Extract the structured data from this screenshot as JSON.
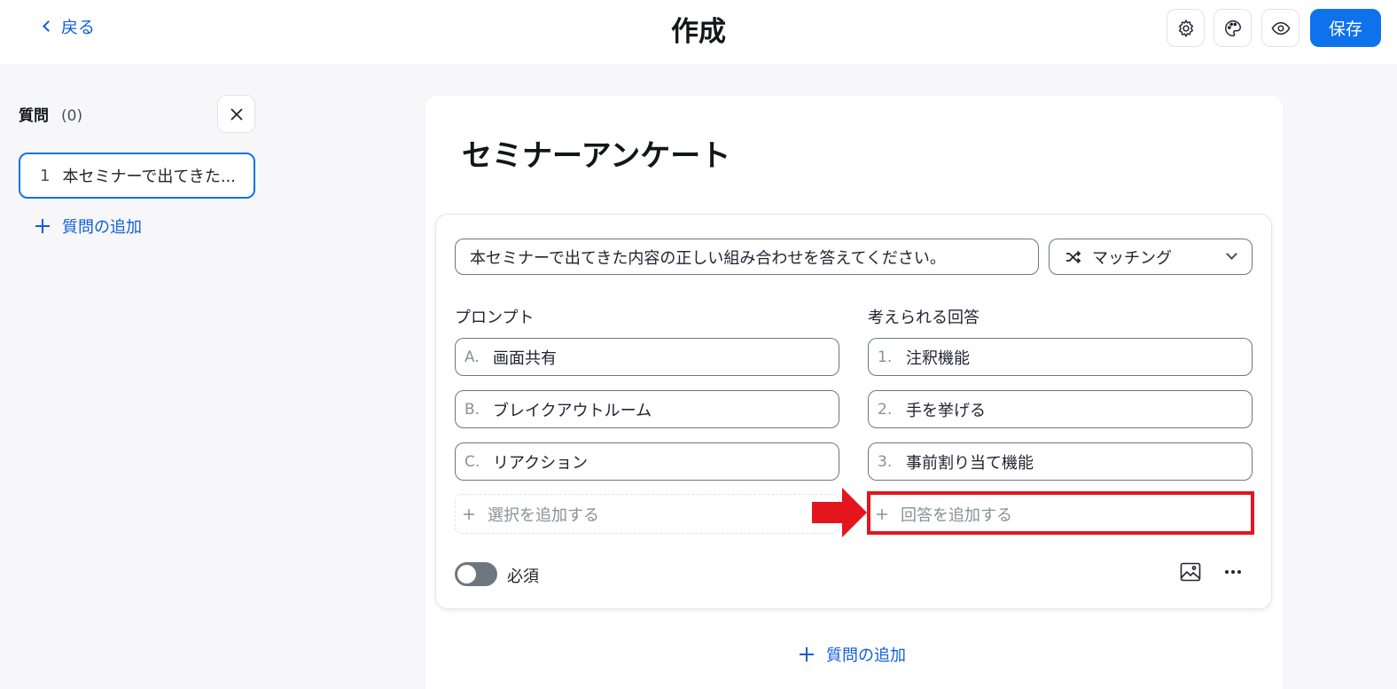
{
  "header": {
    "back_label": "戻る",
    "title": "作成",
    "save_label": "保存",
    "icons": [
      "gear-icon",
      "palette-icon",
      "eye-icon"
    ]
  },
  "sidebar": {
    "title": "質問",
    "count": "(0)",
    "items": [
      {
        "number": "1",
        "label": "本セミナーで出てきた..."
      }
    ],
    "add_label": "質問の追加"
  },
  "main": {
    "survey_title": "セミナーアンケート",
    "question": {
      "text": "本セミナーで出てきた内容の正しい組み合わせを答えてください。",
      "type": "マッチング",
      "prompts_header": "プロンプト",
      "answers_header": "考えられる回答",
      "prompts": [
        {
          "mark": "A.",
          "text": "画面共有"
        },
        {
          "mark": "B.",
          "text": "ブレイクアウトルーム"
        },
        {
          "mark": "C.",
          "text": "リアクション"
        }
      ],
      "answers": [
        {
          "mark": "1.",
          "text": "注釈機能"
        },
        {
          "mark": "2.",
          "text": "手を挙げる"
        },
        {
          "mark": "3.",
          "text": "事前割り当て機能"
        }
      ],
      "add_choice_label": "選択を追加する",
      "add_answer_label": "回答を追加する",
      "required_label": "必須",
      "required": false
    },
    "add_question_label": "質問の追加"
  },
  "colors": {
    "accent": "#0e72ed",
    "link": "#0e5fd8",
    "highlight": "#e3151d"
  }
}
